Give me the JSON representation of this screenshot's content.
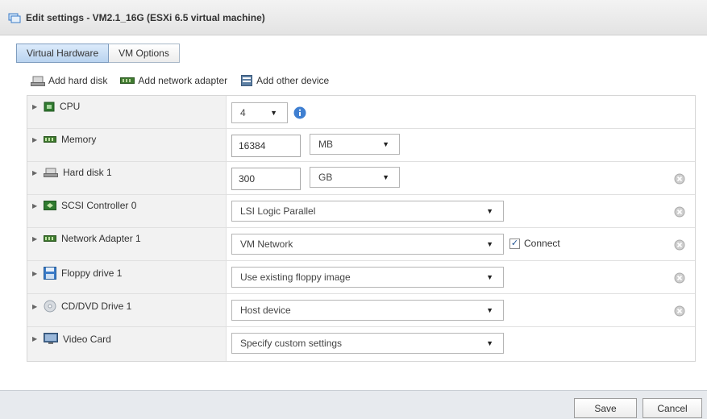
{
  "window": {
    "title": "Edit settings - VM2.1_16G (ESXi 6.5 virtual machine)"
  },
  "tabs": [
    {
      "label": "Virtual Hardware",
      "active": true
    },
    {
      "label": "VM Options",
      "active": false
    }
  ],
  "toolbar": {
    "add_hard_disk": "Add hard disk",
    "add_network_adapter": "Add network adapter",
    "add_other_device": "Add other device"
  },
  "hardware": {
    "cpu": {
      "label": "CPU",
      "value": "4"
    },
    "memory": {
      "label": "Memory",
      "value": "16384",
      "unit": "MB"
    },
    "hard_disk": {
      "label": "Hard disk 1",
      "value": "300",
      "unit": "GB"
    },
    "scsi": {
      "label": "SCSI Controller 0",
      "value": "LSI Logic Parallel"
    },
    "network": {
      "label": "Network Adapter 1",
      "value": "VM Network",
      "connect_label": "Connect",
      "connected": true
    },
    "floppy": {
      "label": "Floppy drive 1",
      "value": "Use existing floppy image"
    },
    "cddvd": {
      "label": "CD/DVD Drive 1",
      "value": "Host device"
    },
    "video": {
      "label": "Video Card",
      "value": "Specify custom settings"
    }
  },
  "footer": {
    "save_label": "Save",
    "cancel_label": "Cancel"
  },
  "colors": {
    "accent": "#3a7bc8",
    "tab_active": "#c8def5",
    "label_bg": "#f2f2f2"
  }
}
